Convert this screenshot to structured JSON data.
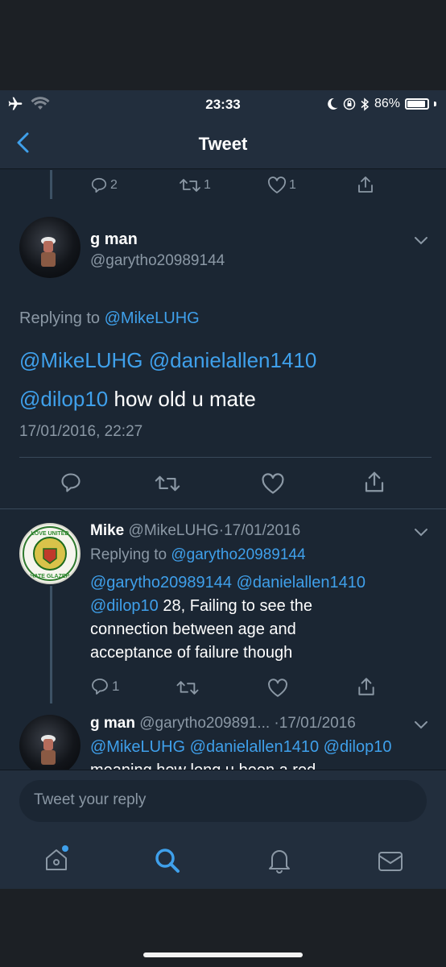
{
  "status_bar": {
    "time": "23:33",
    "battery": "86%",
    "battery_level": 0.86,
    "icons": [
      "airplane-icon",
      "wifi-icon",
      "moon-icon",
      "orientation-lock-icon",
      "bluetooth-icon",
      "battery-icon"
    ]
  },
  "nav": {
    "title": "Tweet",
    "back_icon": "chevron-left-icon"
  },
  "prev_tweet_actions": {
    "replies": "2",
    "retweets": "1",
    "likes": "1"
  },
  "main_tweet": {
    "name": "g man",
    "handle": "@garytho20989144",
    "replying_label": "Replying to",
    "replying_to": "@MikeLUHG",
    "mention1": "@MikeLUHG",
    "mention2": "@danielallen1410",
    "mention3": "@dilop10",
    "text": "how old u mate",
    "timestamp": "17/01/2016, 22:27"
  },
  "reply1": {
    "name": "Mike",
    "handle": "@MikeLUHG",
    "date": "17/01/2016",
    "sep": "·",
    "replying_label": "Replying to",
    "replying_to": "@garytho20989144",
    "mention1": "@garytho20989144",
    "mention2": "@danielallen1410",
    "mention3": "@dilop10",
    "text_a": "28, Failing to see the",
    "text_b": "connection between age and",
    "text_c": "acceptance of failure though",
    "replies": "1",
    "avatar_text": "LOVE UNITED HATE GLAZER"
  },
  "reply2": {
    "name": "g man",
    "handle": "@garytho209891...",
    "sep": "·",
    "date": "17/01/2016",
    "mentions": "@MikeLUHG @danielallen1410 @dilop10",
    "text": "meaning how long u been a red"
  },
  "reply_box": {
    "placeholder": "Tweet your reply"
  },
  "tabs": [
    "home-icon",
    "search-icon",
    "notifications-icon",
    "messages-icon"
  ],
  "colors": {
    "background": "#1b2633",
    "bar": "#222e3d",
    "link": "#3fa0eb",
    "muted": "#8b98a5"
  }
}
